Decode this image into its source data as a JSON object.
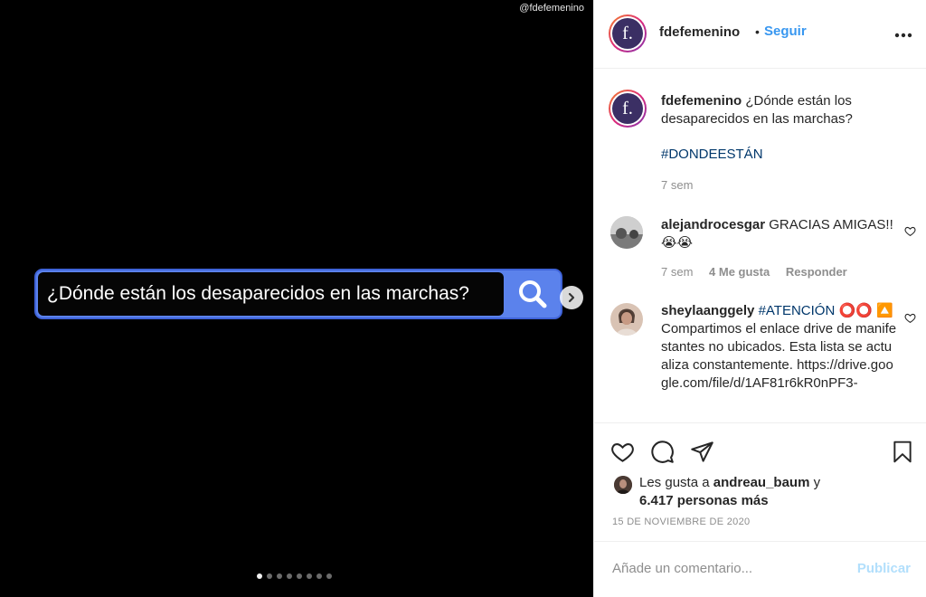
{
  "media": {
    "watermark": "@fdefemenino",
    "search_text": "¿Dónde están los desaparecidos en las marchas?",
    "search_icon": "search-icon",
    "next_icon": "chevron-right-icon",
    "dot_count": 8,
    "active_dot": 0,
    "colors": {
      "search_border": "#3f63d8",
      "search_button": "#5b82ec",
      "background": "#000000"
    }
  },
  "header": {
    "username": "fdefemenino",
    "separator": "•",
    "follow_label": "Seguir",
    "more_label": "•••",
    "avatar_letter": "f."
  },
  "caption": {
    "username": "fdefemenino",
    "text": "¿Dónde están los desaparecidos en las marchas?",
    "hashtag": "#DONDEESTÁN",
    "time": "7 sem"
  },
  "comments": [
    {
      "username": "alejandrocesgar",
      "text": "GRACIAS AMIGAS!! 😭😭",
      "time": "7 sem",
      "likes": "4 Me gusta",
      "reply": "Responder"
    },
    {
      "username": "sheylaanggely",
      "hashtag": "#ATENCIÓN",
      "emoji": "⭕⭕",
      "text": "🔼Compartimos el enlace drive de manifestantes no ubicados. Esta lista se actualiza constantemente. https://drive.google.com/file/d/1AF81r6kR0nPF3-"
    }
  ],
  "likes": {
    "prefix": "Les gusta a",
    "user": "andreau_baum",
    "joiner": "y",
    "others": "6.417 personas más"
  },
  "date": "15 DE NOVIEMBRE DE 2020",
  "composer": {
    "placeholder": "Añade un comentario...",
    "publish_label": "Publicar"
  },
  "colors": {
    "accent": "#3897f0",
    "hashtag": "#00376b",
    "muted": "#8e8e8e",
    "publish_disabled": "#b2dffc"
  }
}
